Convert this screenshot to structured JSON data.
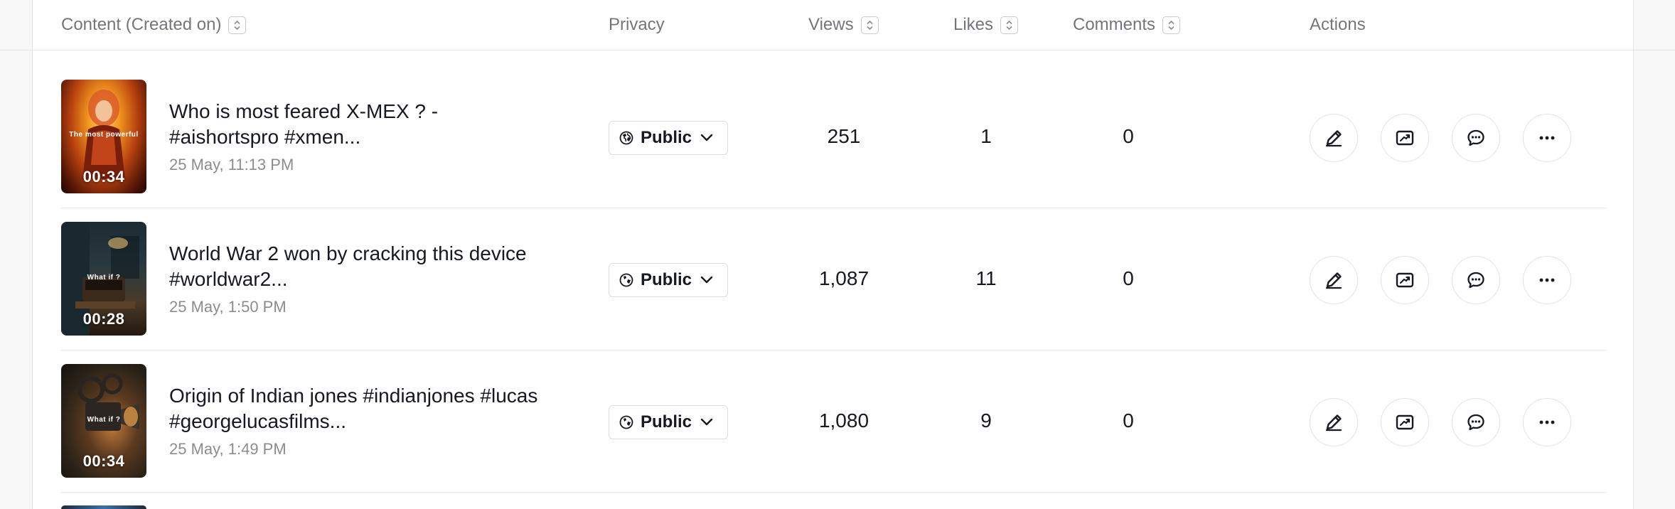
{
  "header": {
    "content": "Content (Created on)",
    "privacy": "Privacy",
    "views": "Views",
    "likes": "Likes",
    "comments": "Comments",
    "actions": "Actions"
  },
  "rows": [
    {
      "title": "Who is most feared X-MEX ? - #aishortspro #xmen...",
      "date": "25 May, 11:13 PM",
      "duration": "00:34",
      "thumb_text": "The most powerful",
      "privacy": "Public",
      "views": "251",
      "likes": "1",
      "comments": "0"
    },
    {
      "title": "World War 2 won by cracking this device #worldwar2...",
      "date": "25 May, 1:50 PM",
      "duration": "00:28",
      "thumb_text": "What if ?",
      "privacy": "Public",
      "views": "1,087",
      "likes": "11",
      "comments": "0"
    },
    {
      "title": "Origin of Indian jones #indianjones #lucas #georgelucasfilms...",
      "date": "25 May, 1:49 PM",
      "duration": "00:34",
      "thumb_text": "What if ?",
      "privacy": "Public",
      "views": "1,080",
      "likes": "9",
      "comments": "0"
    }
  ],
  "icons": {
    "sort": "sort-icon",
    "globe": "globe-icon",
    "chevron": "chevron-down-icon",
    "edit": "pencil-icon",
    "analytics": "analytics-icon",
    "comments": "comment-icon",
    "more": "more-icon"
  }
}
